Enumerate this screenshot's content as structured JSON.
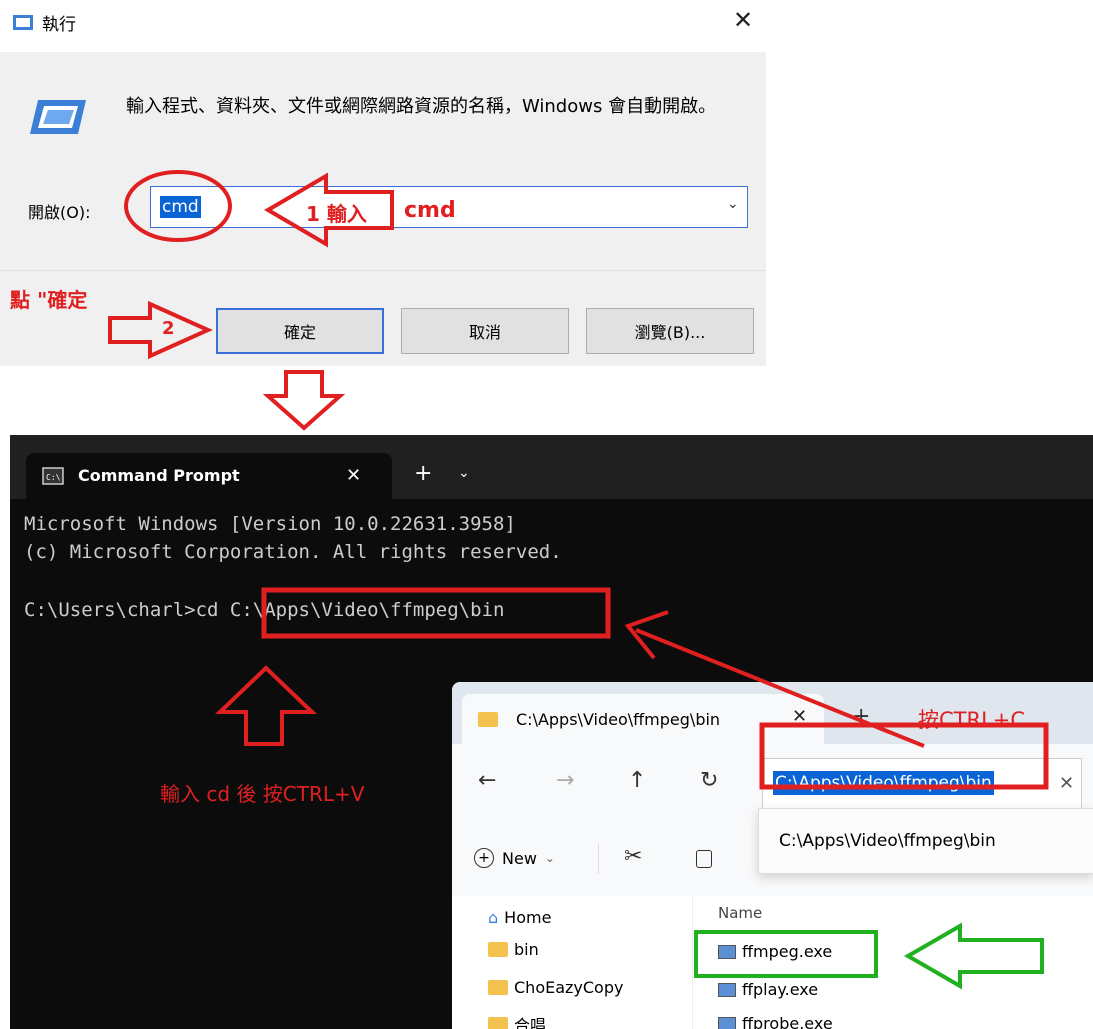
{
  "run_dialog": {
    "title": "執行",
    "close_glyph": "✕",
    "description": "輸入程式、資料夾、文件或網際網路資源的名稱，Windows 會自動開啟。",
    "open_label": "開啟(O):",
    "open_value": "cmd",
    "ok_label": "確定",
    "cancel_label": "取消",
    "browse_label": "瀏覽(B)..."
  },
  "annotations": {
    "step1_num": "1 輸入",
    "step1_text": "cmd",
    "step2_caption": "點 \"確定",
    "step2_num": "2",
    "paste_hint": "輸入 cd 後 按CTRL+V",
    "copy_hint": "按CTRL+C"
  },
  "cmd_window": {
    "tab_title": "Command Prompt",
    "tab_close": "✕",
    "new_tab": "+",
    "dropdown": "⌄",
    "line1": "Microsoft Windows [Version 10.0.22631.3958]",
    "line2": "(c) Microsoft Corporation. All rights reserved.",
    "prompt": "C:\\Users\\charl>cd ",
    "path": "C:\\Apps\\Video\\ffmpeg\\bin"
  },
  "explorer": {
    "tab_title": "C:\\Apps\\Video\\ffmpeg\\bin",
    "tab_close": "✕",
    "new_tab": "+",
    "nav_back": "←",
    "nav_forward": "→",
    "nav_up": "↑",
    "nav_refresh": "↻",
    "address_value": "C:\\Apps\\Video\\ffmpeg\\bin",
    "address_clear": "✕",
    "suggestion": "C:\\Apps\\Video\\ffmpeg\\bin",
    "new_label": "New",
    "new_chevron": "⌄",
    "sidebar": [
      {
        "label": "Home"
      },
      {
        "label": "bin"
      },
      {
        "label": "ChoEazyCopy"
      },
      {
        "label": "合唱"
      }
    ],
    "column_name": "Name",
    "files": [
      {
        "label": "ffmpeg.exe"
      },
      {
        "label": "ffplay.exe"
      },
      {
        "label": "ffprobe.exe"
      }
    ]
  },
  "colors": {
    "annotation_red": "#e02020",
    "annotation_green": "#20b020",
    "selection_blue": "#0a64d6"
  }
}
